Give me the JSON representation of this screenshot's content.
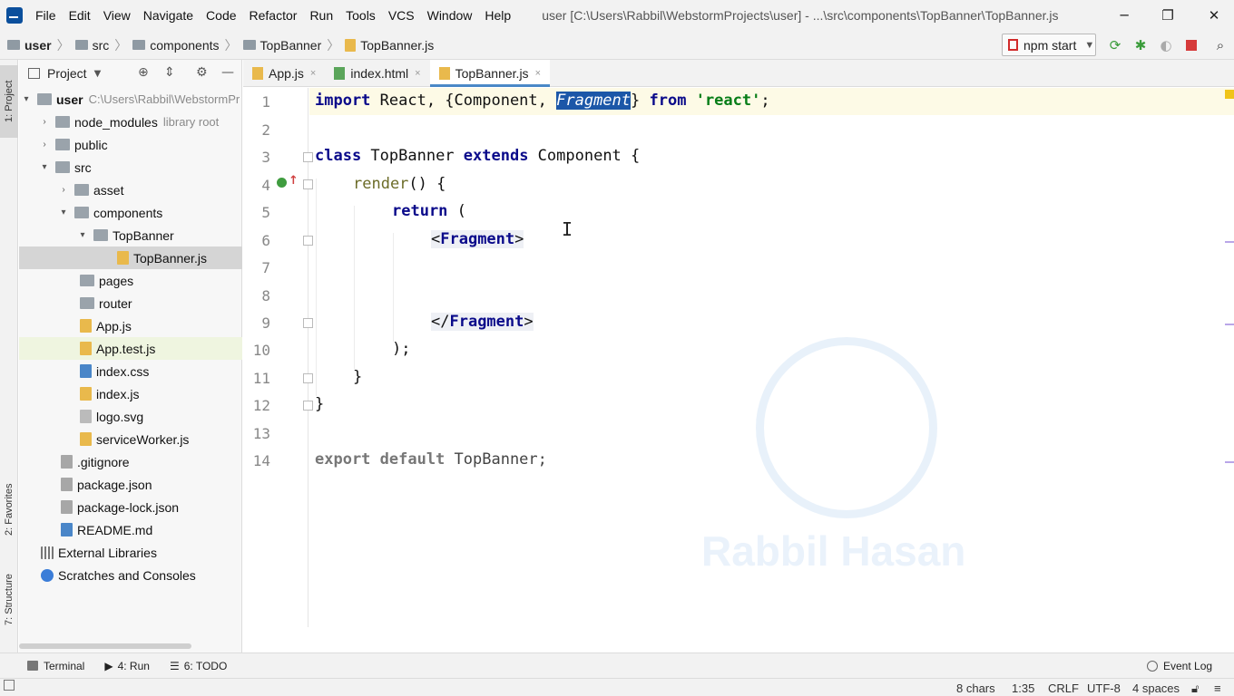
{
  "menu": [
    "File",
    "Edit",
    "View",
    "Navigate",
    "Code",
    "Refactor",
    "Run",
    "Tools",
    "VCS",
    "Window",
    "Help"
  ],
  "window_title": "user [C:\\Users\\Rabbil\\WebstormProjects\\user] - ...\\src\\components\\TopBanner\\TopBanner.js",
  "breadcrumb": [
    "user",
    "src",
    "components",
    "TopBanner",
    "TopBanner.js"
  ],
  "run_config": "npm start",
  "left_tabs": {
    "project": "1: Project",
    "favorites": "2: Favorites",
    "structure": "7: Structure"
  },
  "project_panel": {
    "title": "Project",
    "tree": [
      {
        "label": "user",
        "hint": "C:\\Users\\Rabbil\\WebstormPr",
        "icon": "folder-icon",
        "arrow": "▾"
      },
      {
        "label": "node_modules",
        "hint": "library root",
        "icon": "folder-icon",
        "arrow": "›"
      },
      {
        "label": "public",
        "icon": "folder-icon",
        "arrow": "›"
      },
      {
        "label": "src",
        "icon": "folder-icon",
        "arrow": "▾"
      },
      {
        "label": "asset",
        "icon": "folder-icon",
        "arrow": "›"
      },
      {
        "label": "components",
        "icon": "folder-icon",
        "arrow": "▾"
      },
      {
        "label": "TopBanner",
        "icon": "folder-icon",
        "arrow": "▾"
      },
      {
        "label": "TopBanner.js",
        "icon": "js-file-icon",
        "arrow": ""
      },
      {
        "label": "pages",
        "icon": "folder-icon",
        "arrow": ""
      },
      {
        "label": "router",
        "icon": "folder-icon",
        "arrow": ""
      },
      {
        "label": "App.js",
        "icon": "js-file-icon",
        "arrow": ""
      },
      {
        "label": "App.test.js",
        "icon": "js-file-icon",
        "arrow": ""
      },
      {
        "label": "index.css",
        "icon": "css-file-icon",
        "arrow": ""
      },
      {
        "label": "index.js",
        "icon": "js-file-icon",
        "arrow": ""
      },
      {
        "label": "logo.svg",
        "icon": "svg-file-icon",
        "arrow": ""
      },
      {
        "label": "serviceWorker.js",
        "icon": "js-file-icon",
        "arrow": ""
      },
      {
        "label": ".gitignore",
        "icon": "json-file-icon",
        "arrow": ""
      },
      {
        "label": "package.json",
        "icon": "json-file-icon",
        "arrow": ""
      },
      {
        "label": "package-lock.json",
        "icon": "json-file-icon",
        "arrow": ""
      },
      {
        "label": "README.md",
        "icon": "md-file-icon",
        "arrow": ""
      },
      {
        "label": "External Libraries",
        "icon": "library-icon",
        "arrow": ""
      },
      {
        "label": "Scratches and Consoles",
        "icon": "scratch-icon",
        "arrow": ""
      }
    ]
  },
  "tabs": [
    {
      "label": "App.js",
      "close": "×"
    },
    {
      "label": "index.html",
      "close": "×"
    },
    {
      "label": "TopBanner.js",
      "close": "×"
    }
  ],
  "editor": {
    "line_numbers": [
      "1",
      "2",
      "3",
      "4",
      "5",
      "6",
      "7",
      "8",
      "9",
      "10",
      "11",
      "12",
      "13",
      "14"
    ],
    "code": {
      "l1_import": "import",
      "l1_a": " React, {Component, ",
      "l1_sel": "Fragment",
      "l1_b": "} ",
      "l1_from": "from",
      "l1_sp": " ",
      "l1_str": "'react'",
      "l1_end": ";",
      "l3_class": "class",
      "l3_name": " TopBanner ",
      "l3_extends": "extends",
      "l3_rest": " Component {",
      "l4_fn": "render",
      "l4_rest": "() {",
      "l5_return": "return",
      "l5_rest": " (",
      "l6_open": "<",
      "l6_tag": "Fragment",
      "l6_close": ">",
      "l9_open": "</",
      "l9_tag": "Fragment",
      "l9_close": ">",
      "l10": ");",
      "l11": "}",
      "l12": "}",
      "l14_export": "export default",
      "l14_rest": " TopBanner;"
    },
    "watermark": "Rabbil Hasan"
  },
  "bottom_tools": [
    "Terminal",
    "4: Run",
    "6: TODO"
  ],
  "event_log": "Event Log",
  "status": {
    "chars": "8 chars",
    "position": "1:35",
    "line_sep": "CRLF",
    "encoding": "UTF-8",
    "indent": "4 spaces"
  }
}
